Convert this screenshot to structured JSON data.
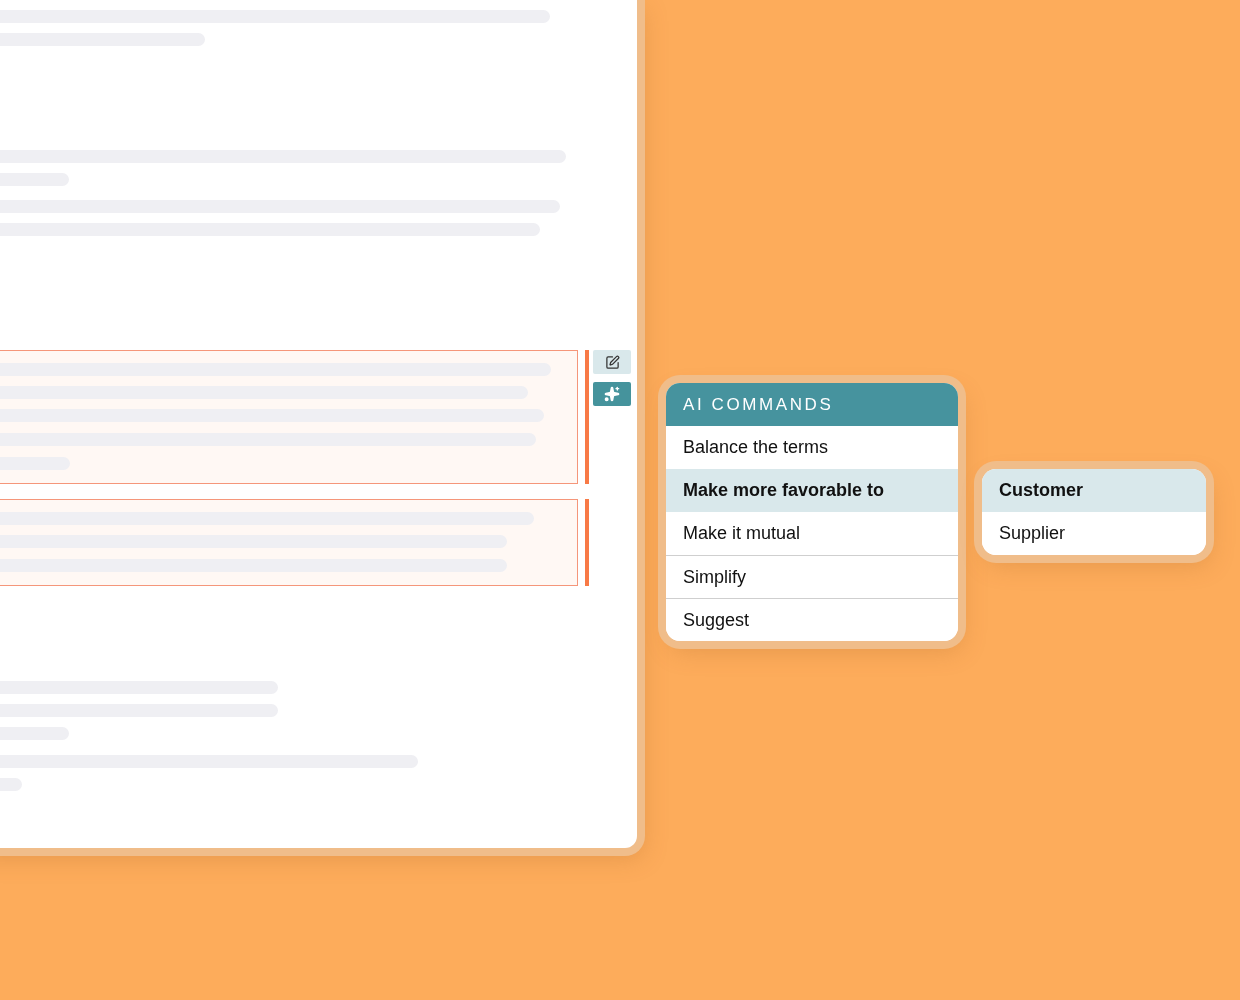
{
  "menu": {
    "title": "AI COMMANDS",
    "items": [
      {
        "label": "Balance the terms",
        "selected": false
      },
      {
        "label": "Make more favorable to",
        "selected": true
      },
      {
        "label": "Make it mutual",
        "selected": false
      },
      {
        "label": "Simplify",
        "selected": false
      },
      {
        "label": "Suggest",
        "selected": false
      }
    ]
  },
  "submenu": {
    "items": [
      {
        "label": "Customer",
        "selected": true
      },
      {
        "label": "Supplier",
        "selected": false
      }
    ]
  }
}
